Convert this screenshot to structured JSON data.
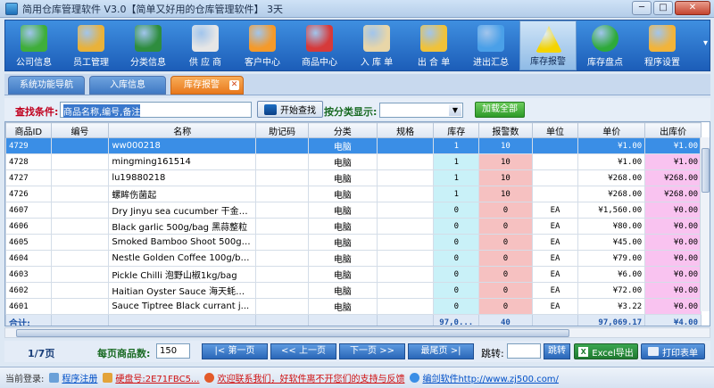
{
  "window": {
    "title": "简用仓库管理软件  V3.0【简单又好用的仓库管理软件】  3天",
    "min": "─",
    "max": "□",
    "close": "✕"
  },
  "toolbar": [
    {
      "label": "公司信息",
      "icon": "house-icon",
      "color": "#3fae3a"
    },
    {
      "label": "员工管理",
      "icon": "staff-icon",
      "color": "#e9b23a"
    },
    {
      "label": "分类信息",
      "icon": "book-icon",
      "color": "#2e8d3e"
    },
    {
      "label": "供 应 商",
      "icon": "truck-icon",
      "color": "#e6e6e6"
    },
    {
      "label": "客户中心",
      "icon": "customers-icon",
      "color": "#f59a2a"
    },
    {
      "label": "商品中心",
      "icon": "cubes-icon",
      "color": "#d63a3a"
    },
    {
      "label": "入 库 单",
      "icon": "warehouse-icon",
      "color": "#e8d6a8"
    },
    {
      "label": "出 合 单",
      "icon": "lock-icon",
      "color": "#f0c23a"
    },
    {
      "label": "进出汇总",
      "icon": "org-chart-icon",
      "color": "#4aa0e8"
    },
    {
      "label": "库存报警",
      "icon": "warning-icon",
      "color": "#f4d400"
    },
    {
      "label": "库存盘点",
      "icon": "pie-chart-icon",
      "color": "#2eaa3a"
    },
    {
      "label": "程序设置",
      "icon": "gear-icon",
      "color": "#f2b43a"
    }
  ],
  "tabs": [
    {
      "label": "系统功能导航",
      "active": false
    },
    {
      "label": "入库信息",
      "active": false
    },
    {
      "label": "库存报警",
      "active": true
    }
  ],
  "search": {
    "label": "查找条件:",
    "placeholder": "商品名称,编号,备注",
    "find_button": "开始查找",
    "category_label": "按分类显示:",
    "load_all_button": "加载全部"
  },
  "table": {
    "columns": [
      "商品ID",
      "编号",
      "名称",
      "助记码",
      "分类",
      "规格",
      "库存",
      "报警数",
      "单位",
      "单价",
      "出库价"
    ],
    "rows": [
      [
        "4729",
        "",
        "ww000218",
        "",
        "电脑",
        "",
        "1",
        "10",
        "",
        "¥1.00",
        "¥1.00"
      ],
      [
        "4728",
        "",
        "mingming161514",
        "",
        "电脑",
        "",
        "1",
        "10",
        "",
        "¥1.00",
        "¥1.00"
      ],
      [
        "4727",
        "",
        "lu19880218",
        "",
        "电脑",
        "",
        "1",
        "10",
        "",
        "¥268.00",
        "¥268.00"
      ],
      [
        "4726",
        "",
        "螺眸伤菌起",
        "",
        "电脑",
        "",
        "1",
        "10",
        "",
        "¥268.00",
        "¥268.00"
      ],
      [
        "4607",
        "",
        "Dry Jinyu sea cucumber 干金玉参",
        "",
        "电脑",
        "",
        "0",
        "0",
        "EA",
        "¥1,560.00",
        "¥0.00"
      ],
      [
        "4606",
        "",
        "Black garlic 500g/bag 黑蒜整粒",
        "",
        "电脑",
        "",
        "0",
        "0",
        "EA",
        "¥80.00",
        "¥0.00"
      ],
      [
        "4605",
        "",
        "Smoked Bamboo Shoot 500g/bag ...",
        "",
        "电脑",
        "",
        "0",
        "0",
        "EA",
        "¥45.00",
        "¥0.00"
      ],
      [
        "4604",
        "",
        "Nestle Golden Coffee 100g/bot...",
        "",
        "电脑",
        "",
        "0",
        "0",
        "EA",
        "¥79.00",
        "¥0.00"
      ],
      [
        "4603",
        "",
        "Pickle Chilli 泡野山椒1kg/bag",
        "",
        "电脑",
        "",
        "0",
        "0",
        "EA",
        "¥6.00",
        "¥0.00"
      ],
      [
        "4602",
        "",
        "Haitian Oyster Sauce 海天蚝油6KG",
        "",
        "电脑",
        "",
        "0",
        "0",
        "EA",
        "¥72.00",
        "¥0.00"
      ],
      [
        "4601",
        "",
        "Sauce Tiptree Black currant j...",
        "",
        "电脑",
        "",
        "0",
        "0",
        "EA",
        "¥3.22",
        "¥0.00"
      ]
    ],
    "total": {
      "label": "合计:",
      "stock": "97,0...",
      "alarm": "40",
      "price": "97,069.17",
      "out_price": "¥4.00"
    }
  },
  "pager": {
    "page_info": "1/7页",
    "per_page_label": "每页商品数:",
    "per_page_value": "150",
    "first": "|< 第一页",
    "prev": "<< 上一页",
    "next": "下一页 >>",
    "last": "最尾页 >|",
    "jump_label": "跳转:",
    "jump_button": "跳转",
    "excel_button": "Excel导出",
    "print_button": "打印表单"
  },
  "status": {
    "login_label": "当前登录:",
    "register": "程序注册",
    "disk_label": "硬盘号:2E71FBC5...",
    "contact": "欢迎联系我们，好软件离不开您们的支持与反馈",
    "website": "编剑软件http://www.zj500.com/"
  }
}
